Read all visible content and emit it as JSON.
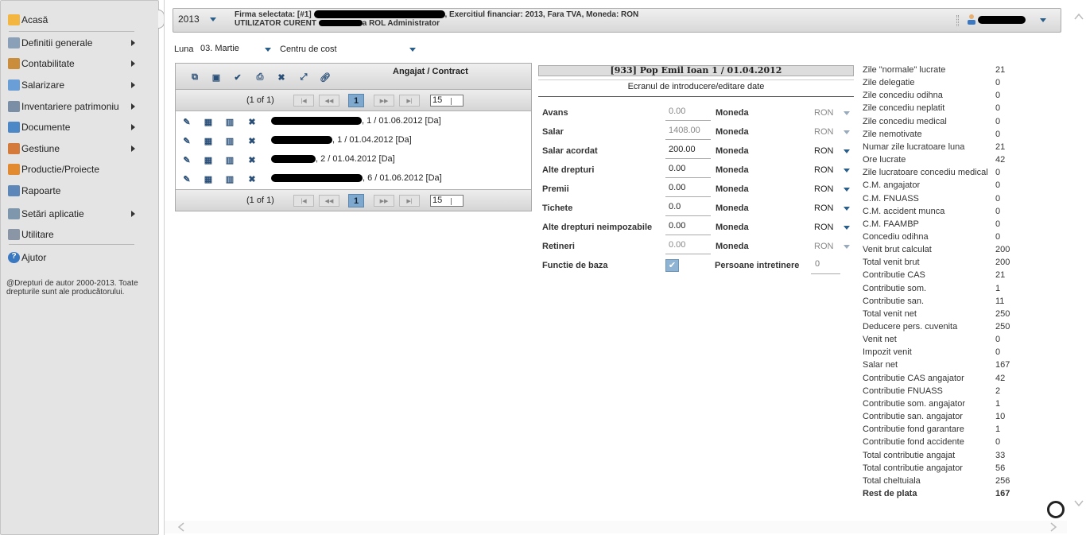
{
  "sidebar": {
    "items": [
      {
        "label": "Acasă",
        "icon": "home-icon",
        "arrow": false
      },
      {
        "label": "Definitii generale",
        "icon": "gears-icon",
        "arrow": true
      },
      {
        "label": "Contabilitate",
        "icon": "ledger-icon",
        "arrow": true
      },
      {
        "label": "Salarizare",
        "icon": "payroll-icon",
        "arrow": true
      },
      {
        "label": "Inventariere patrimoniu",
        "icon": "inventory-icon",
        "arrow": true
      },
      {
        "label": "Documente",
        "icon": "documents-icon",
        "arrow": true
      },
      {
        "label": "Gestiune",
        "icon": "management-icon",
        "arrow": true
      },
      {
        "label": "Productie/Proiecte",
        "icon": "truck-icon",
        "arrow": false
      },
      {
        "label": "Rapoarte",
        "icon": "reports-icon",
        "arrow": false
      },
      {
        "label": "Setări aplicatie",
        "icon": "settings-icon",
        "arrow": true
      },
      {
        "label": "Utilitare",
        "icon": "tools-icon",
        "arrow": false
      },
      {
        "label": "Ajutor",
        "icon": "help-icon",
        "arrow": false
      }
    ],
    "copyright": "@Drepturi de autor 2000-2013. Toate drepturile sunt ale producătorului."
  },
  "topbar": {
    "year": "2013",
    "firm_prefix": "Firma selectata:  [#1]",
    "firm_suffix": ",  Exercitiul financiar: 2013,  Fara TVA,  Moneda: RON",
    "user_prefix": "UTILIZATOR CURENT",
    "user_suffix": "a ROL Administrator"
  },
  "filters": {
    "luna_label": "Luna",
    "luna_value": "03. Martie",
    "cost_center": "Centru de cost"
  },
  "employees": {
    "title": "Angajat / Contract",
    "page_info": "(1 of 1)",
    "current_page": "1",
    "page_size": "15",
    "rows": [
      {
        "suffix": ", 1 / 01.06.2012 [Da]"
      },
      {
        "suffix": ", 1 / 01.04.2012 [Da]"
      },
      {
        "suffix": ", 2 / 01.04.2012 [Da]"
      },
      {
        "suffix": ", 6 / 01.06.2012 [Da]"
      }
    ]
  },
  "form": {
    "header": "[933] Pop Emil Ioan 1 / 01.04.2012",
    "subheader": "Ecranul de introducere/editare date",
    "currency_label": "Moneda",
    "fields": [
      {
        "label": "Avans",
        "value": "0.00",
        "currency": "RON",
        "disabled": true
      },
      {
        "label": "Salar",
        "value": "1408.00",
        "currency": "RON",
        "disabled": true
      },
      {
        "label": "Salar acordat",
        "value": "200.00",
        "currency": "RON",
        "disabled": false
      },
      {
        "label": "Alte drepturi",
        "value": "0.00",
        "currency": "RON",
        "disabled": false
      },
      {
        "label": "Premii",
        "value": "0.00",
        "currency": "RON",
        "disabled": false
      },
      {
        "label": "Tichete",
        "value": "0.0",
        "currency": "RON",
        "disabled": false
      },
      {
        "label": "Alte drepturi neimpozabile",
        "value": "0.00",
        "currency": "RON",
        "disabled": false
      },
      {
        "label": "Retineri",
        "value": "0.00",
        "currency": "RON",
        "disabled": true
      }
    ],
    "base_function_label": "Functie de baza",
    "dependents_label": "Persoane intretinere",
    "dependents_value": "0"
  },
  "summary": [
    {
      "k": "Zile \"normale\" lucrate",
      "v": "21"
    },
    {
      "k": "Zile delegatie",
      "v": "0"
    },
    {
      "k": "Zile concediu odihna",
      "v": "0"
    },
    {
      "k": "Zile concediu neplatit",
      "v": "0"
    },
    {
      "k": "Zile concediu medical",
      "v": "0"
    },
    {
      "k": "Zile nemotivate",
      "v": "0"
    },
    {
      "k": "Numar zile lucratoare luna",
      "v": "21"
    },
    {
      "k": "Ore lucrate",
      "v": "42"
    },
    {
      "k": "Zile lucratoare concediu medical",
      "v": "0"
    },
    {
      "k": "C.M. angajator",
      "v": "0"
    },
    {
      "k": "C.M. FNUASS",
      "v": "0"
    },
    {
      "k": "C.M. accident munca",
      "v": "0"
    },
    {
      "k": "C.M. FAAMBP",
      "v": "0"
    },
    {
      "k": "Concediu odihna",
      "v": "0"
    },
    {
      "k": "Venit brut calculat",
      "v": "200"
    },
    {
      "k": "Total venit brut",
      "v": "200"
    },
    {
      "k": "Contributie CAS",
      "v": "21"
    },
    {
      "k": "Contributie som.",
      "v": "1"
    },
    {
      "k": "Contributie san.",
      "v": "11"
    },
    {
      "k": "Total venit net",
      "v": "250"
    },
    {
      "k": "Deducere pers. cuvenita",
      "v": "250"
    },
    {
      "k": "Venit net",
      "v": "0"
    },
    {
      "k": "Impozit venit",
      "v": "0"
    },
    {
      "k": "Salar net",
      "v": "167"
    },
    {
      "k": "Contributie CAS angajator",
      "v": "42"
    },
    {
      "k": "Contributie FNUASS",
      "v": "2"
    },
    {
      "k": "Contributie som. angajator",
      "v": "1"
    },
    {
      "k": "Contributie san. angajator",
      "v": "10"
    },
    {
      "k": "Contributie fond garantare",
      "v": "1"
    },
    {
      "k": "Contributie fond accidente",
      "v": "0"
    },
    {
      "k": "Total contributie angajat",
      "v": "33"
    },
    {
      "k": "Total contributie angajator",
      "v": "56"
    },
    {
      "k": "Total cheltuiala",
      "v": "256"
    },
    {
      "k": "Rest de plata",
      "v": "167",
      "bold": true
    }
  ]
}
